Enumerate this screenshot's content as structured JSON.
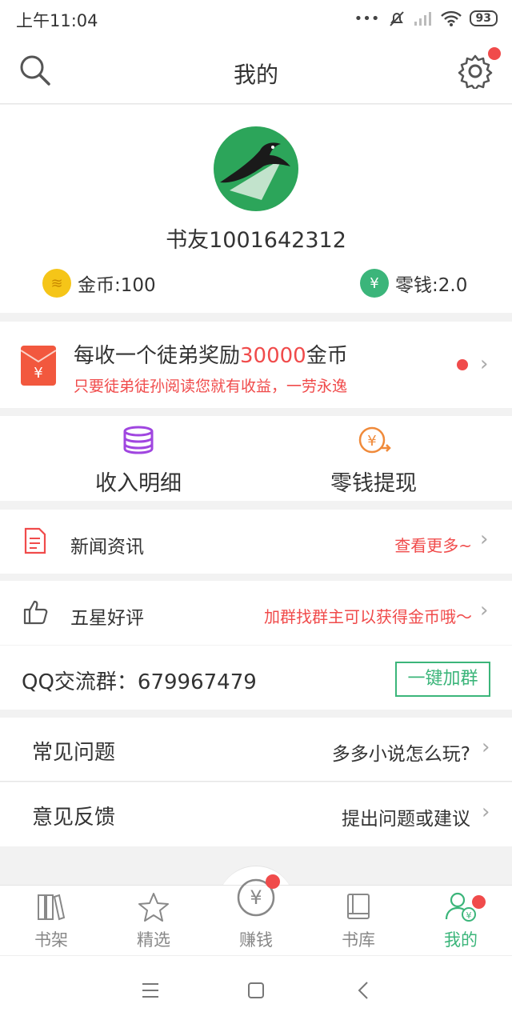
{
  "status": {
    "time": "上午11:04",
    "battery": "93"
  },
  "header": {
    "title": "我的"
  },
  "profile": {
    "username": "书友1001642312",
    "coins_label": "金币:100",
    "change_label": "零钱:2.0"
  },
  "invite": {
    "title_prefix": "每收一个徒弟奖励",
    "title_highlight": "30000",
    "title_suffix": "金币",
    "subtitle": "只要徒弟徒孙阅读您就有收益，一劳永逸"
  },
  "quick": {
    "income_label": "收入明细",
    "withdraw_label": "零钱提现"
  },
  "news": {
    "label": "新闻资讯",
    "more": "查看更多~"
  },
  "review": {
    "label": "五星好评",
    "hint": "加群找群主可以获得金币哦～"
  },
  "qq": {
    "label": "QQ交流群：679967479",
    "button": "一键加群"
  },
  "faq": {
    "label": "常见问题",
    "value": "多多小说怎么玩?"
  },
  "feedback": {
    "label": "意见反馈",
    "value": "提出问题或建议"
  },
  "tabs": [
    {
      "label": "书架"
    },
    {
      "label": "精选"
    },
    {
      "label": "赚钱"
    },
    {
      "label": "书库"
    },
    {
      "label": "我的"
    }
  ],
  "colors": {
    "accent": "#3bb57a",
    "alert": "#f04b4b"
  }
}
